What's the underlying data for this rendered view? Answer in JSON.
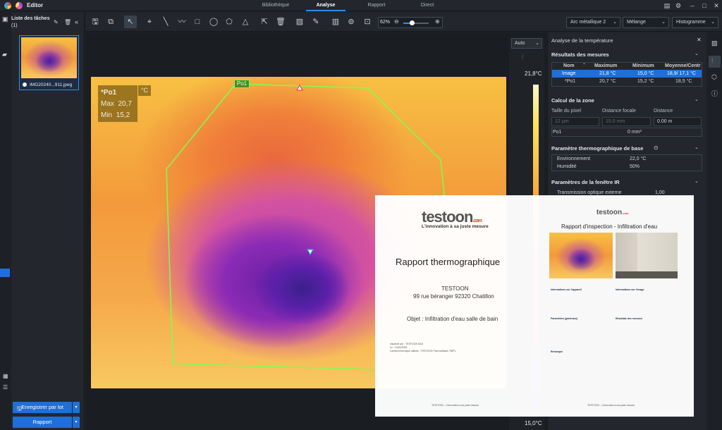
{
  "app": {
    "title": "Editor"
  },
  "nav": {
    "tabs": [
      "Bibliothèque",
      "Analyse",
      "Rapport",
      "Direct"
    ],
    "active": "Analyse"
  },
  "task_list": {
    "title": "Liste des tâches",
    "count": "(1)",
    "thumbnail_label": "IMG20240...911.jpeg"
  },
  "buttons": {
    "save_batch": "Enregistrer par lot",
    "report": "Rapport"
  },
  "toolbar": {
    "zoom": "62%"
  },
  "dropdowns": {
    "palette": "Arc métallique 2",
    "blend": "Mélange",
    "histogram": "Histogramme"
  },
  "colorbar": {
    "mode": "Auto",
    "max": "21,8°C",
    "min": "15,0°C"
  },
  "overlay": {
    "name": "*Po1",
    "unit": "°C",
    "max_label": "Max",
    "max_value": "20,7",
    "min_label": "Min",
    "min_value": "15,2",
    "tag": "Po1"
  },
  "panel": {
    "title": "Analyse de la température",
    "results_title": "Résultats des mesures",
    "columns": [
      "Nom",
      "Maximum",
      "Minimum",
      "Moyenne/Centr"
    ],
    "rows": [
      {
        "name": "Image",
        "max": "21,8 °C",
        "min": "15,0 °C",
        "avg": "18,9/ 17,1 °C"
      },
      {
        "name": "*Po1",
        "max": "20,7 °C",
        "min": "15,2 °C",
        "avg": "18,5 °C"
      }
    ],
    "zone_title": "Calcul de la zone",
    "zone_labels": [
      "Taille du pixel",
      "Distance focale",
      "Distance"
    ],
    "zone_values": [
      "12 µm",
      "15.0 mm",
      "0.00 m"
    ],
    "zone_row": {
      "name": "Po1",
      "value": "0 mm²"
    },
    "base_title": "Paramètre thermographique de base",
    "base_rows": [
      {
        "label": "Environnement",
        "value": "22,0 °C"
      },
      {
        "label": "Humidité",
        "value": "50%"
      }
    ],
    "ir_title": "Paramètres de la fenêtre IR",
    "ir_rows": [
      {
        "label": "Transmission optique externe",
        "value": "1,00"
      }
    ]
  },
  "report": {
    "logo": "testoon",
    "logo_suffix": ".com",
    "tagline": "L'innovation à sa juste mesure",
    "title": "Rapport thermographique",
    "company": "TESTOON",
    "address": "99 rue béranger 92320 Chatillon",
    "subject": "Objet : Infiltration d'eau salle de bain",
    "inspected": "Inspecté par : TESTOON SAS",
    "date": "Le : 13/02/2025",
    "camera": "Caméra thermique utilisée : TESTOON ThermoMatch TMP1",
    "page2_title": "Rapport d'inspection - Infiltration d'eau",
    "page2_sections": [
      "Informations sur l'appareil",
      "Informations sur l'image",
      "Paramètres [généraux]",
      "Résultats des mesures",
      "Remarque"
    ],
    "footer": "TESTOON - L'innovation à sa juste mesure"
  },
  "colors": {
    "accent": "#2d8cf0",
    "selection": "#1f6fd9",
    "roi": "#7dff4f"
  }
}
